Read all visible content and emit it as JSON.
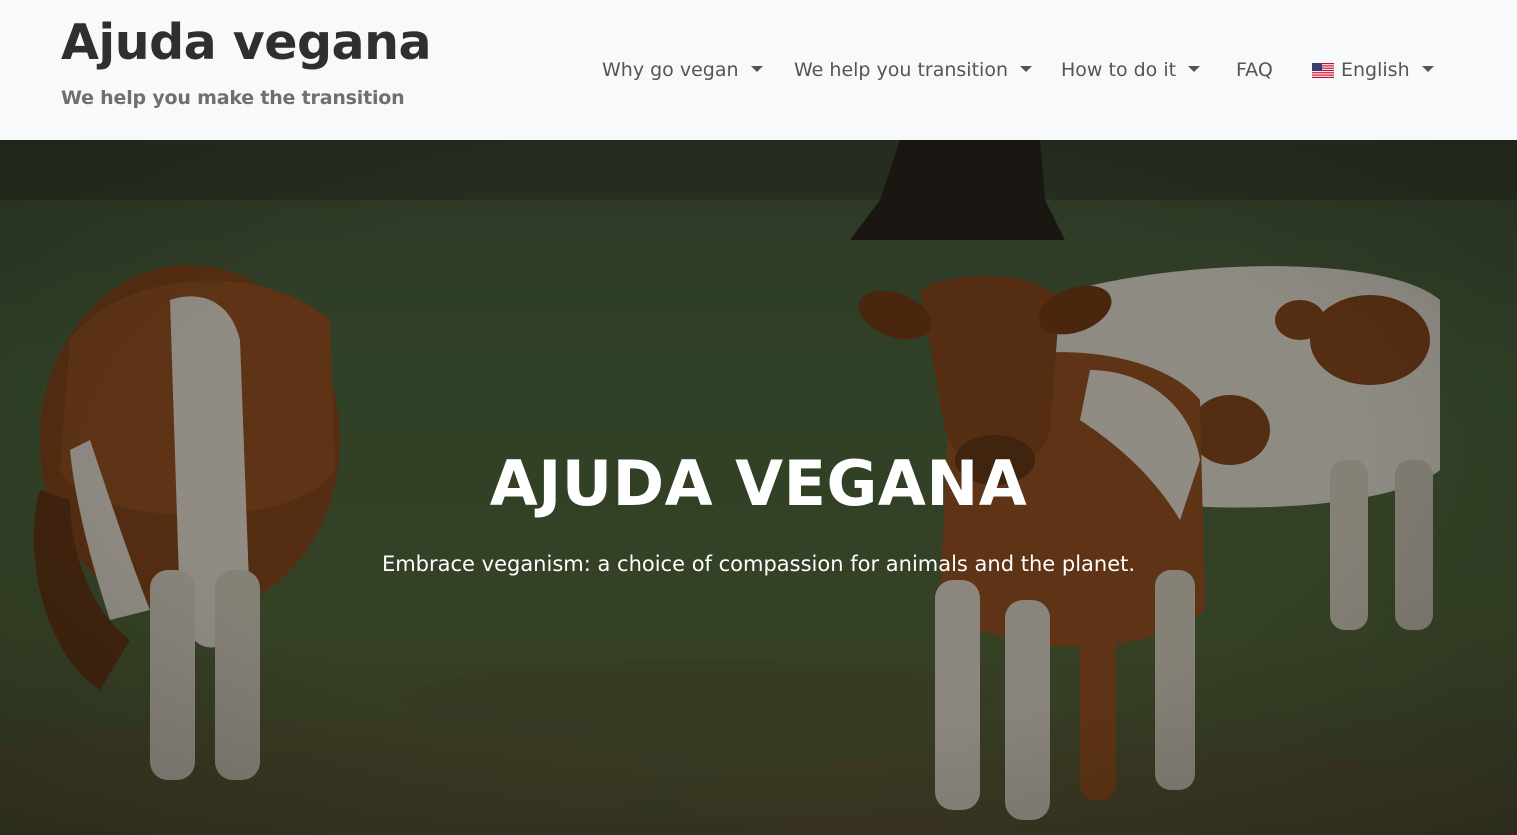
{
  "brand": {
    "title": "Ajuda vegana",
    "subtitle": "We help you make the transition"
  },
  "nav": {
    "items": [
      {
        "label": "Why go vegan",
        "dropdown": true
      },
      {
        "label": "We help you transition",
        "dropdown": true
      },
      {
        "label": "How to do it",
        "dropdown": true
      },
      {
        "label": "FAQ",
        "dropdown": false
      }
    ],
    "language": {
      "label": "English",
      "icon": "us-flag-icon",
      "dropdown": true
    }
  },
  "hero": {
    "title": "AJUDA VEGANA",
    "text": "Embrace veganism: a choice of compassion for animals and the planet.",
    "background": "photo of brown-and-white cows grazing in a grassy field (dark overlay)"
  },
  "colors": {
    "navbar_bg": "#f8f9fa",
    "brand_title": "#2f2f2f",
    "brand_subtitle": "#6f6f6f",
    "nav_text": "#555555",
    "hero_text": "#ffffff"
  }
}
